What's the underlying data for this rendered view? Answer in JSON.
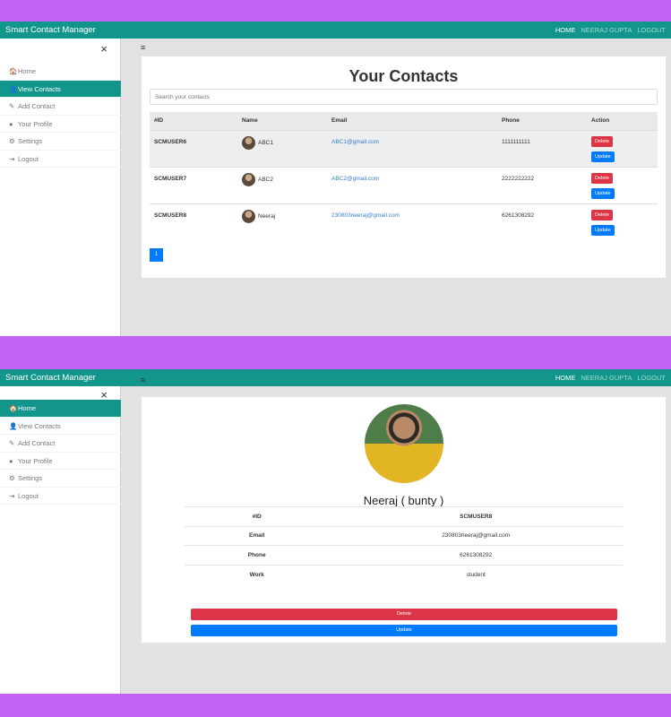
{
  "navbar": {
    "brand": "Smart Contact Manager",
    "links": [
      "HOME",
      "NEERAJ GUPTA",
      "LOGOUT"
    ]
  },
  "sidebar": {
    "close": "×",
    "items": [
      {
        "icon": "🏠",
        "label": "Home"
      },
      {
        "icon": "👤",
        "label": "View Contacts"
      },
      {
        "icon": "✎",
        "label": "Add Contact"
      },
      {
        "icon": "●",
        "label": "Your Profile"
      },
      {
        "icon": "⚙",
        "label": "Settings"
      },
      {
        "icon": "⇥",
        "label": "Logout"
      }
    ]
  },
  "hamburger": "≡",
  "contacts_view": {
    "title": "Your Contacts",
    "search_placeholder": "Search your contacts",
    "headers": [
      "#ID",
      "Name",
      "Email",
      "Phone",
      "Action"
    ],
    "rows": [
      {
        "id": "SCMUSER6",
        "name": "ABC1",
        "email": "ABC1@gmail.com",
        "phone": "1111111111"
      },
      {
        "id": "SCMUSER7",
        "name": "ABC2",
        "email": "ABC2@gmail.com",
        "phone": "2222222222"
      },
      {
        "id": "SCMUSER8",
        "name": "Neeraj",
        "email": "230803neeraj@gmail.com",
        "phone": "6261308292"
      }
    ],
    "delete_label": "Delete",
    "update_label": "Update",
    "page": "1"
  },
  "profile_view": {
    "name": "Neeraj ( bunty )",
    "details": [
      {
        "key": "#ID",
        "value": "SCMUSER8"
      },
      {
        "key": "Email",
        "value": "230803neeraj@gmail.com"
      },
      {
        "key": "Phone",
        "value": "6261308292"
      },
      {
        "key": "Work",
        "value": "student"
      }
    ],
    "delete_label": "Delete",
    "update_label": "Update"
  },
  "colors": {
    "navbar": "#12958a",
    "background": "#c062f2",
    "danger": "#dc3545",
    "primary": "#007bff"
  }
}
